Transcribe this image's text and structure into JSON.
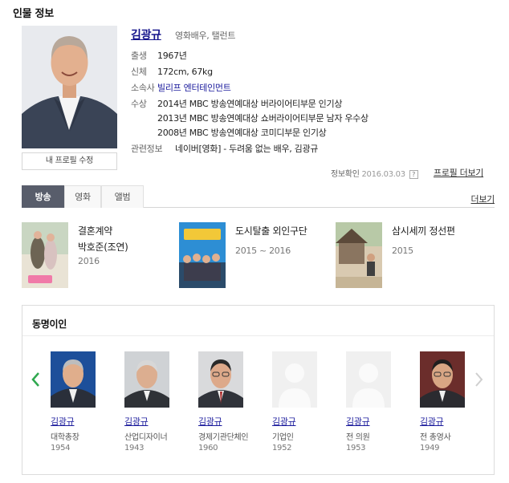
{
  "section_title": "인물 정보",
  "profile": {
    "name": "김광규",
    "occupation": "영화배우, 탤런트",
    "edit_button": "내 프로필 수정",
    "birth_label": "출생",
    "birth_value": "1967년",
    "body_label": "신체",
    "body_value": "172cm, 67kg",
    "agency_label": "소속사",
    "agency_value": "빌리프 엔터테인먼트",
    "award_label": "수상",
    "awards": [
      "2014년 MBC 방송연예대상 버라이어티부문 인기상",
      "2013년 MBC 방송연예대상 쇼버라이어티부문 남자 우수상",
      "2008년 MBC 방송연예대상 코미디부문 인기상"
    ],
    "related_label": "관련정보",
    "related_value": "네이버[영화] - 두려움 없는 배우, 김광규",
    "check_label": "정보확인",
    "check_date": "2016.03.03",
    "help_icon_text": "?",
    "profile_more": "프로필 더보기"
  },
  "tabs": {
    "items": [
      "방송",
      "영화",
      "앨범"
    ],
    "active": "방송",
    "more": "더보기"
  },
  "programs": [
    {
      "title": "결혼계약",
      "role": "박호준(조연)",
      "year": "2016"
    },
    {
      "title": "도시탈출 외인구단",
      "role": "",
      "year": "2015 ~ 2016"
    },
    {
      "title": "삼시세끼 정선편",
      "role": "",
      "year": "2015"
    }
  ],
  "same_name": {
    "title": "동명이인",
    "people": [
      {
        "name": "김광규",
        "job": "대학총장",
        "year": "1954"
      },
      {
        "name": "김광규",
        "job": "산업디자이너",
        "year": "1943"
      },
      {
        "name": "김광규",
        "job": "경제기관단체인",
        "year": "1960"
      },
      {
        "name": "김광규",
        "job": "기업인",
        "year": "1952"
      },
      {
        "name": "김광규",
        "job": "전 의원",
        "year": "1953"
      },
      {
        "name": "김광규",
        "job": "전 총영사",
        "year": "1949"
      }
    ]
  },
  "colors": {
    "name_link": "#14138b",
    "tab_active_bg": "#585d6b",
    "arrow_active": "#2fa84f"
  }
}
